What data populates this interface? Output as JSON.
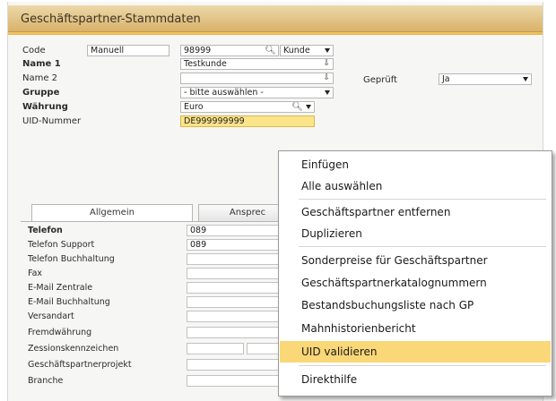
{
  "window": {
    "title": "Geschäftspartner-Stammdaten"
  },
  "form": {
    "code_label": "Code",
    "code_mode": "Manuell",
    "code_value": "98999",
    "code_type": "Kunde",
    "name1_label": "Name 1",
    "name1_value": "Testkunde",
    "name2_label": "Name 2",
    "name2_value": "",
    "gruppe_label": "Gruppe",
    "gruppe_value": "- bitte auswählen -",
    "waehrung_label": "Währung",
    "waehrung_value": "Euro",
    "uid_label": "UID-Nummer",
    "uid_value": "DE999999999",
    "geprueft_label": "Geprüft",
    "geprueft_value": "Ja"
  },
  "tabs": [
    {
      "label": "Allgemein"
    },
    {
      "label": "Ansprec"
    }
  ],
  "general": {
    "rows": [
      {
        "label": "Telefon",
        "value": "089"
      },
      {
        "label": "Telefon Support",
        "value": "089"
      },
      {
        "label": "Telefon Buchhaltung",
        "value": ""
      },
      {
        "label": "Fax",
        "value": ""
      },
      {
        "label": "E-Mail Zentrale",
        "value": ""
      },
      {
        "label": "E-Mail Buchhaltung",
        "value": ""
      },
      {
        "label": "Versandart",
        "value": ""
      },
      {
        "label": "Fremdwährung",
        "value": ""
      },
      {
        "label": "Zessionskennzeichen",
        "value": ""
      },
      {
        "label": "Geschäftspartnerprojekt",
        "value": ""
      },
      {
        "label": "Branche",
        "value": ""
      }
    ]
  },
  "context_menu": {
    "items": [
      {
        "label": "Einfügen"
      },
      {
        "label": "Alle auswählen"
      },
      {
        "label": "Geschäftspartner entfernen"
      },
      {
        "label": "Duplizieren"
      },
      {
        "label": "Sonderpreise für Geschäftspartner"
      },
      {
        "label": "Geschäftspartnerkatalognummern"
      },
      {
        "label": "Bestandsbuchungsliste nach GP"
      },
      {
        "label": "Mahnhistorienbericht"
      },
      {
        "label": "UID validieren",
        "highlighted": true
      },
      {
        "label": "Direkthilfe"
      }
    ]
  },
  "colors": {
    "title_bar": "#d9b26a",
    "highlight": "#fad777",
    "uid_field": "#fce489"
  },
  "icons": {
    "search": "search-icon",
    "dropdown": "chevron-down-icon",
    "link": "link-arrow-icon"
  }
}
